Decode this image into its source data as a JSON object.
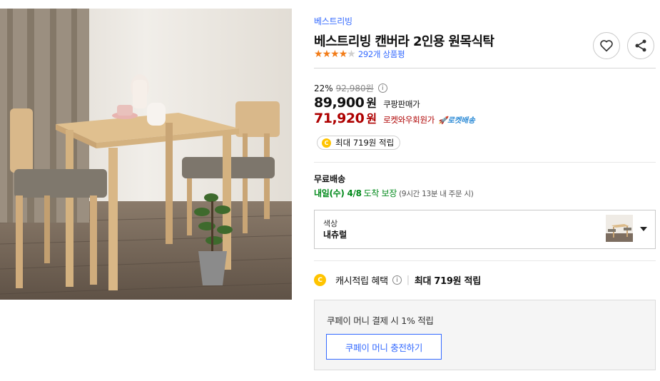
{
  "product": {
    "brand": "베스트리빙",
    "title": "베스트리빙 캔버라 2인용 원목식탁",
    "rating": {
      "stars": 4,
      "max": 5,
      "review_text": "292개 상품평"
    }
  },
  "pricing": {
    "discount_rate": "22%",
    "original_price": "92,980원",
    "sale_price": "89,900",
    "sale_unit": "원",
    "sale_label": "쿠팡판매가",
    "member_price": "71,920",
    "member_unit": "원",
    "member_label": "로켓와우회원가",
    "rocket_badge": "🚀로켓배송"
  },
  "points_pill": {
    "coin": "C",
    "text": "최대 719원 적립"
  },
  "shipping": {
    "title": "무료배송",
    "arrival_date": "내일(수) 4/8",
    "guarantee": "도착 보장",
    "note": "(9시간 13분 내 주문 시)"
  },
  "option": {
    "label": "색상",
    "value": "내츄럴"
  },
  "cash": {
    "coin": "C",
    "label": "캐시적립 혜택",
    "amount_text": "최대 719원 적립"
  },
  "coupay": {
    "text": "쿠페이 머니 결제 시 1% 적립",
    "button": "쿠페이 머니 충전하기"
  },
  "icons": {
    "info": "i",
    "heart": "heart-icon",
    "share": "share-icon",
    "caret": "chevron-down-icon"
  },
  "colors": {
    "accent": "#346aff",
    "member_price": "#ae0000",
    "delivery": "#00891a",
    "star": "#f27c18",
    "coin": "#ffc400"
  }
}
